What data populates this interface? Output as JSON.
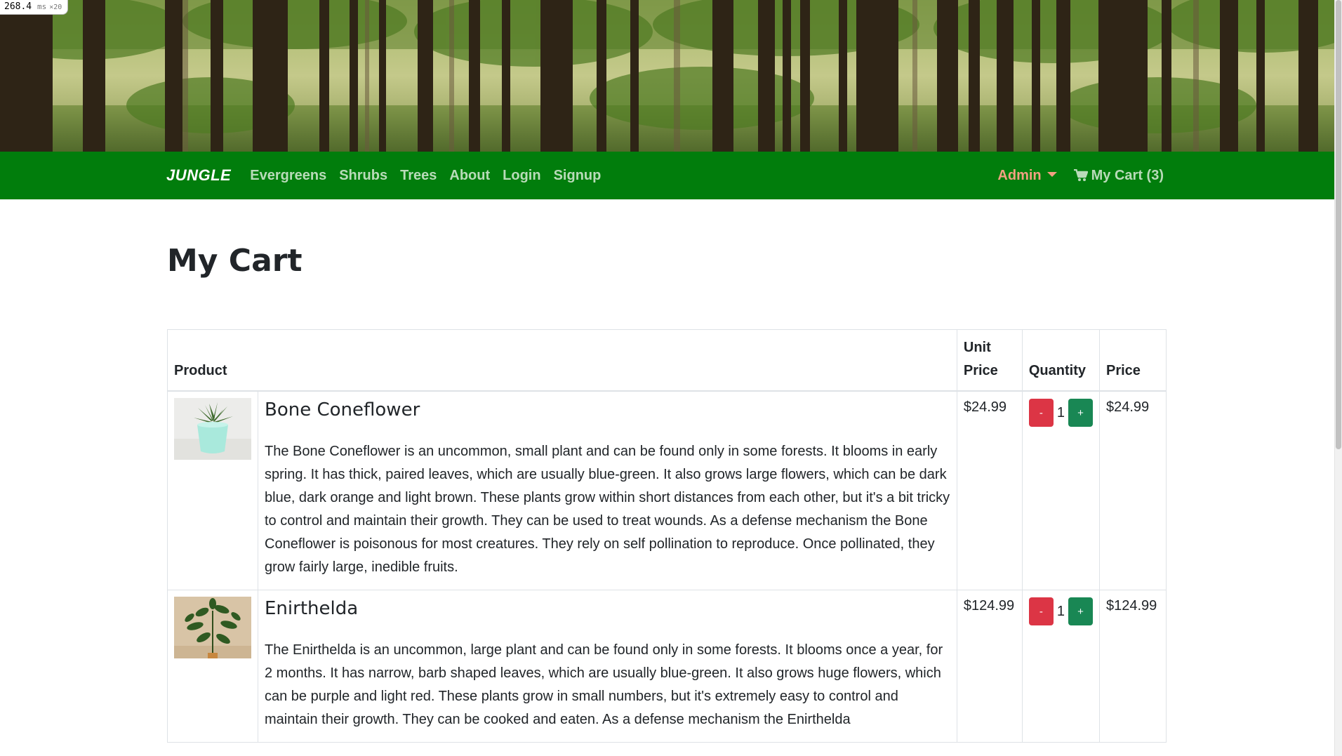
{
  "perf": {
    "value": "268.4",
    "unit": "ms",
    "mult": "×20"
  },
  "nav": {
    "brand": "JUNGLE",
    "links": [
      "Evergreens",
      "Shrubs",
      "Trees",
      "About",
      "Login",
      "Signup"
    ],
    "admin_label": "Admin",
    "cart_label": "My Cart (3)"
  },
  "page": {
    "title": "My Cart"
  },
  "table": {
    "headers": {
      "product": "Product",
      "unit_price": "Unit Price",
      "quantity": "Quantity",
      "price": "Price"
    },
    "rows": [
      {
        "name": "Bone Coneflower",
        "image": "potted-succulent",
        "description": "The Bone Coneflower is an uncommon, small plant and can be found only in some forests. It blooms in early spring. It has thick, paired leaves, which are usually blue-green. It also grows large flowers, which can be dark blue, dark orange and light brown. These plants grow within short distances from each other, but it's a bit tricky to control and maintain their growth. They can be used to treat wounds. As a defense mechanism the Bone Coneflower is poisonous for most creatures. They rely on self pollination to reproduce. Once pollinated, they grow fairly large, inedible fruits.",
        "unit_price": "$24.99",
        "quantity": "1",
        "price": "$24.99",
        "minus_label": "-",
        "plus_label": "+"
      },
      {
        "name": "Enirthelda",
        "image": "leafy-plant",
        "description": "The Enirthelda is an uncommon, large plant and can be found only in some forests. It blooms once a year, for 2 months. It has narrow, barb shaped leaves, which are usually blue-green. It also grows huge flowers, which can be purple and light red. These plants grow in small numbers, but it's extremely easy to control and maintain their growth. They can be cooked and eaten. As a defense mechanism the Enirthelda",
        "unit_price": "$124.99",
        "quantity": "1",
        "price": "$124.99",
        "minus_label": "-",
        "plus_label": "+"
      }
    ]
  },
  "colors": {
    "navbar": "#017d0c",
    "admin": "#f2a082",
    "minus_button": "#dc3545",
    "plus_button": "#198754"
  }
}
